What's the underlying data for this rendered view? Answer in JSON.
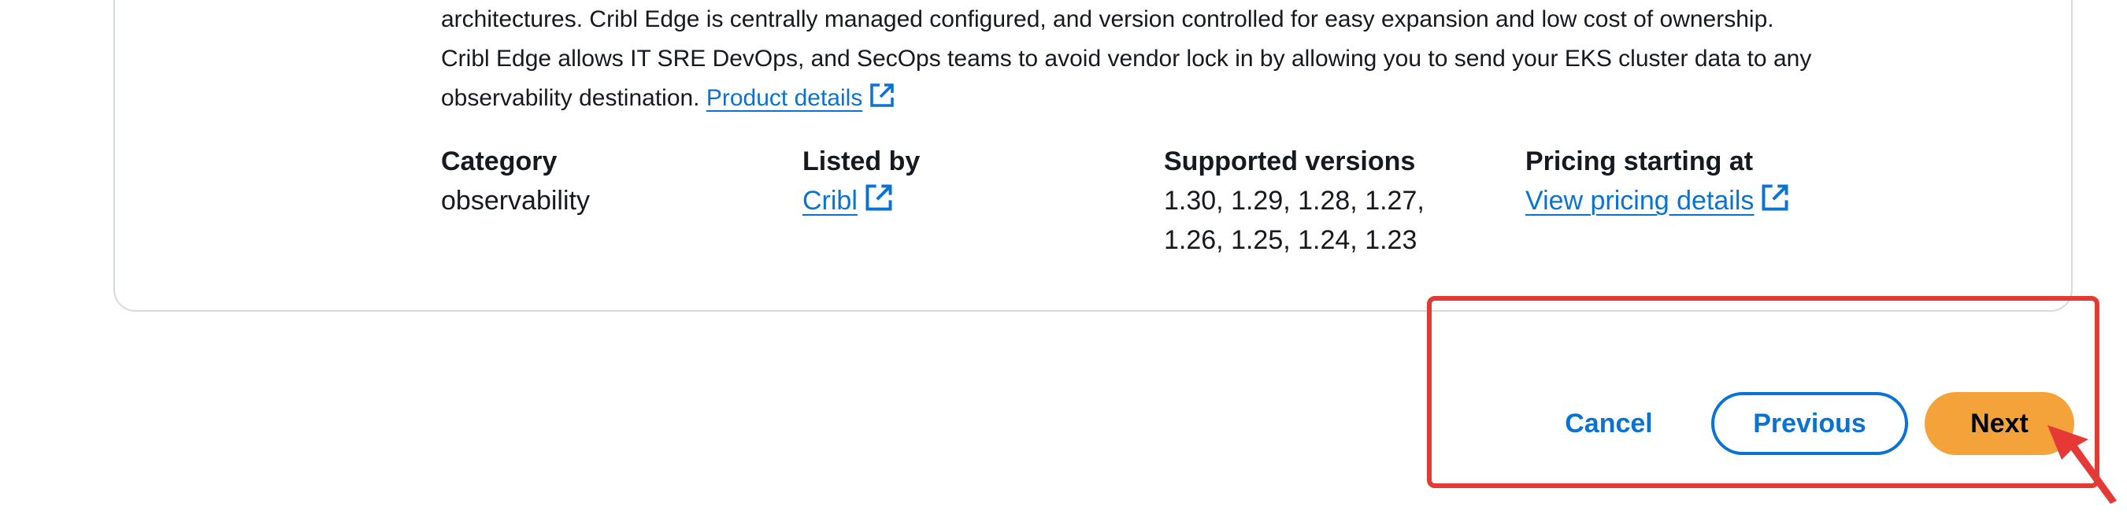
{
  "description": {
    "line1": "architectures. Cribl Edge is centrally managed configured, and version controlled for easy expansion and low cost of ownership.",
    "line2": "Cribl Edge allows IT SRE DevOps, and SecOps teams to avoid vendor lock in by allowing you to send your EKS cluster data to any",
    "line3_text": "observability destination.",
    "product_details_link": "Product details"
  },
  "details": {
    "category": {
      "label": "Category",
      "value": "observability"
    },
    "listed_by": {
      "label": "Listed by",
      "value": "Cribl"
    },
    "supported_versions": {
      "label": "Supported versions",
      "line1": "1.30, 1.29, 1.28, 1.27,",
      "line2": "1.26, 1.25, 1.24, 1.23"
    },
    "pricing": {
      "label": "Pricing starting at",
      "link": "View pricing details"
    }
  },
  "footer": {
    "cancel_label": "Cancel",
    "previous_label": "Previous",
    "next_label": "Next"
  },
  "colors": {
    "link": "#0972d3",
    "primary_button": "#f4a23a",
    "highlight": "#e53935"
  },
  "icons": {
    "external_link": "external-link-icon",
    "annotation_arrow": "arrow-icon"
  }
}
